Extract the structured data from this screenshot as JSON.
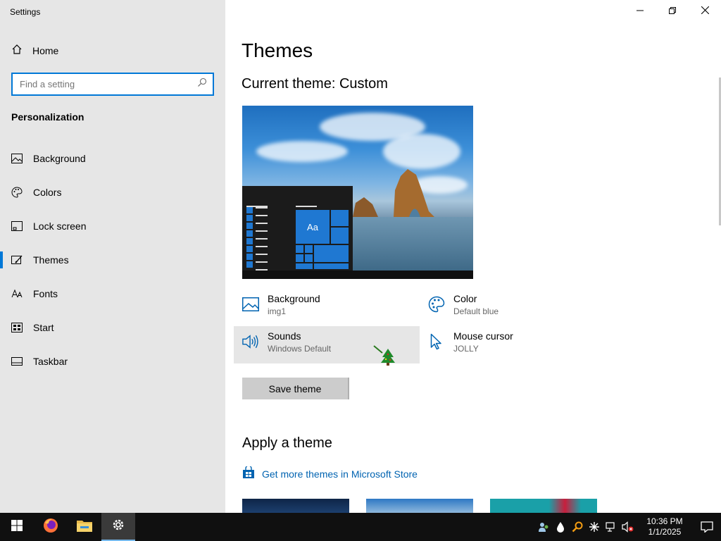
{
  "window": {
    "title": "Settings",
    "controls": [
      "minimize",
      "restore",
      "close"
    ]
  },
  "sidebar": {
    "home_label": "Home",
    "search_placeholder": "Find a setting",
    "section_title": "Personalization",
    "items": [
      {
        "label": "Background",
        "icon": "picture-icon"
      },
      {
        "label": "Colors",
        "icon": "palette-icon"
      },
      {
        "label": "Lock screen",
        "icon": "lock-screen-icon"
      },
      {
        "label": "Themes",
        "icon": "themes-icon",
        "active": true
      },
      {
        "label": "Fonts",
        "icon": "fonts-icon"
      },
      {
        "label": "Start",
        "icon": "start-icon"
      },
      {
        "label": "Taskbar",
        "icon": "taskbar-icon"
      }
    ]
  },
  "main": {
    "page_title": "Themes",
    "current_theme": "Current theme: Custom",
    "preview_tile_label": "Aa",
    "properties": [
      {
        "name": "Background",
        "value": "img1",
        "icon": "picture-icon"
      },
      {
        "name": "Color",
        "value": "Default blue",
        "icon": "palette-icon"
      },
      {
        "name": "Sounds",
        "value": "Windows Default",
        "icon": "speaker-icon"
      },
      {
        "name": "Mouse cursor",
        "value": "JOLLY",
        "icon": "cursor-icon"
      }
    ],
    "save_button": "Save theme",
    "apply_title": "Apply a theme",
    "store_link": "Get more themes in Microsoft Store"
  },
  "taskbar": {
    "apps": [
      "start-icon",
      "firefox-icon",
      "file-explorer-icon",
      "settings-icon"
    ],
    "time": "10:36 PM",
    "date": "1/1/2025"
  },
  "colors": {
    "accent": "#0078d7",
    "link": "#0063b1",
    "sidebar_bg": "#e6e6e6",
    "taskbar_bg": "#101010"
  }
}
